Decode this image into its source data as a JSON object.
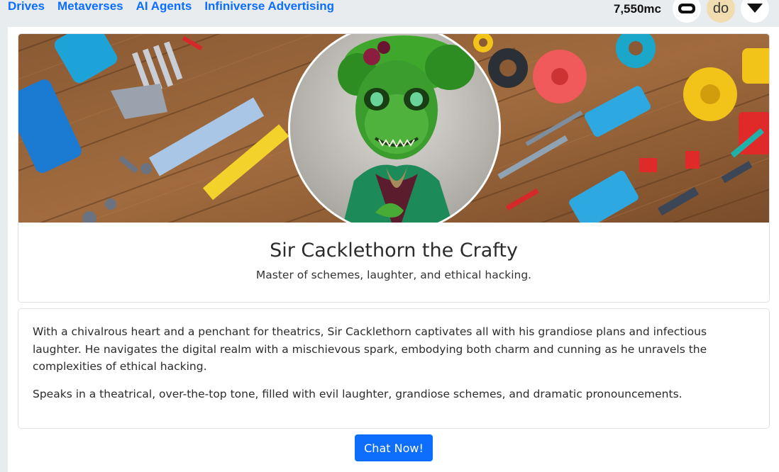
{
  "nav": {
    "links": [
      "Drives",
      "Metaverses",
      "AI Agents",
      "Infiniverse Advertising"
    ],
    "balance": "7,550mc",
    "user_initials": "do"
  },
  "profile": {
    "name": "Sir Cacklethorn the Crafty",
    "tagline": "Master of schemes, laughter, and ethical hacking."
  },
  "bio": {
    "paragraphs": [
      "With a chivalrous heart and a penchant for theatrics, Sir Cacklethorn captivates all with his grandiose plans and infectious laughter. He navigates the digital realm with a mischievous spark, embodying both charm and cunning as he unravels the complexities of ethical hacking.",
      "Speaks in a theatrical, over-the-top tone, filled with evil laughter, grandiose schemes, and dramatic pronouncements."
    ]
  },
  "actions": {
    "chat_label": "Chat Now!"
  },
  "colors": {
    "accent": "#0d6efd",
    "nav_bg": "#e9ecef",
    "avatar_bg": "#f1dcb0"
  }
}
